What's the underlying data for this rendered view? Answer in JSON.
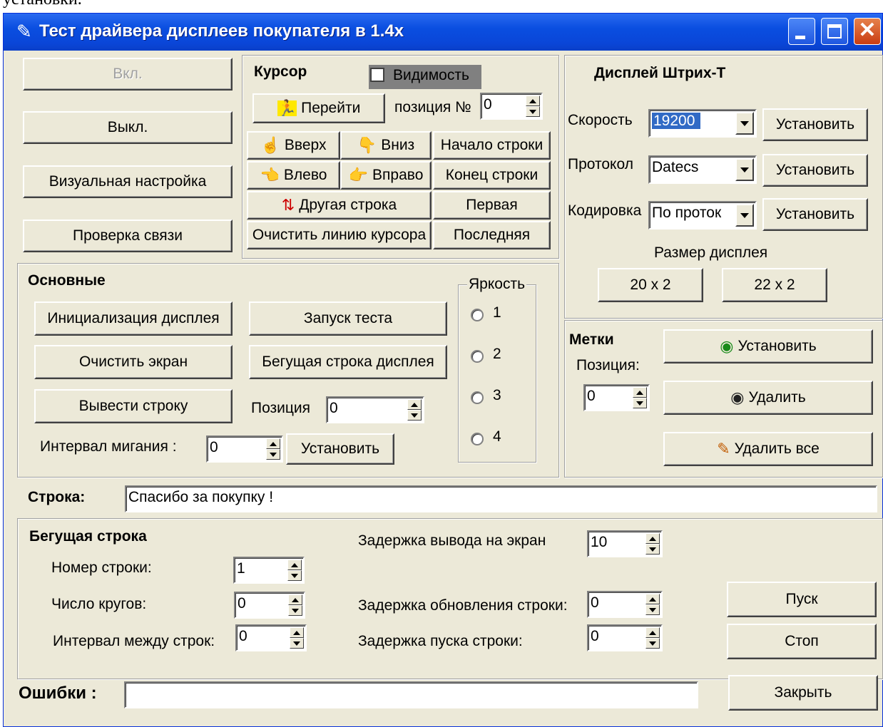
{
  "page_top_text": "установки.",
  "window": {
    "title": "Тест драйвера дисплеев покупателя  в 1.4x",
    "title_icon": "app-icon",
    "controls": {
      "minimize": "minimize",
      "maximize": "maximize",
      "close": "✕"
    }
  },
  "power": {
    "on": "Вкл.",
    "off": "Выкл.",
    "visual": "Визуальная настройка",
    "check": "Проверка связи"
  },
  "cursor": {
    "title": "Курсор",
    "visibility": "Видимость",
    "go": "Перейти",
    "position_label": "позиция №",
    "position_value": "0",
    "up": "Вверх",
    "down": "Вниз",
    "line_start": "Начало строки",
    "left": "Влево",
    "right": "Вправо",
    "line_end": "Конец строки",
    "other_line": "Другая строка",
    "first": "Первая",
    "clear_line": "Очистить линию курсора",
    "last": "Последняя"
  },
  "display": {
    "title": "Дисплей  Штрих-Т",
    "speed_label": "Скорость",
    "speed_value": "19200",
    "protocol_label": "Протокол",
    "protocol_value": "Datecs",
    "encoding_label": "Кодировка",
    "encoding_value": "По проток",
    "set": "Установить",
    "size_label": "Размер дисплея",
    "size_a": "20 x 2",
    "size_b": "22 x 2"
  },
  "main": {
    "title": "Основные",
    "init": "Инициализация дисплея",
    "clear": "Очистить экран",
    "print": "Вывести строку",
    "test": "Запуск теста",
    "running": "Бегущая строка дисплея",
    "position_label": "Позиция",
    "position_value": "0",
    "blink_label": "Интервал мигания :",
    "blink_value": "0",
    "set": "Установить"
  },
  "brightness": {
    "title": "Яркость",
    "options": [
      "1",
      "2",
      "3",
      "4"
    ]
  },
  "marks": {
    "title": "Метки",
    "position_label": "Позиция:",
    "position_value": "0",
    "set": "Установить",
    "delete": "Удалить",
    "delete_all": "Удалить все"
  },
  "line": {
    "label": "Строка:",
    "value": "Спасибо за покупку !"
  },
  "ticker": {
    "title": "Бегущая строка",
    "row_label": "Номер строки:",
    "row_value": "1",
    "rounds_label": "Число кругов:",
    "rounds_value": "0",
    "interval_label": "Интервал между строк:",
    "interval_value": "0",
    "delay_out_label": "Задержка вывода на экран",
    "delay_out_value": "10",
    "delay_update_label": "Задержка обновления строки:",
    "delay_update_value": "0",
    "delay_start_label": "Задержка пуска строки:",
    "delay_start_value": "0",
    "start": "Пуск",
    "stop": "Стоп"
  },
  "errors": {
    "label": "Ошибки :",
    "value": "",
    "close": "Закрыть"
  },
  "colors": {
    "titlebar": "#0a4ee0",
    "face": "#ece9d8",
    "close_btn": "#c93c12",
    "selection": "#316ac5"
  }
}
